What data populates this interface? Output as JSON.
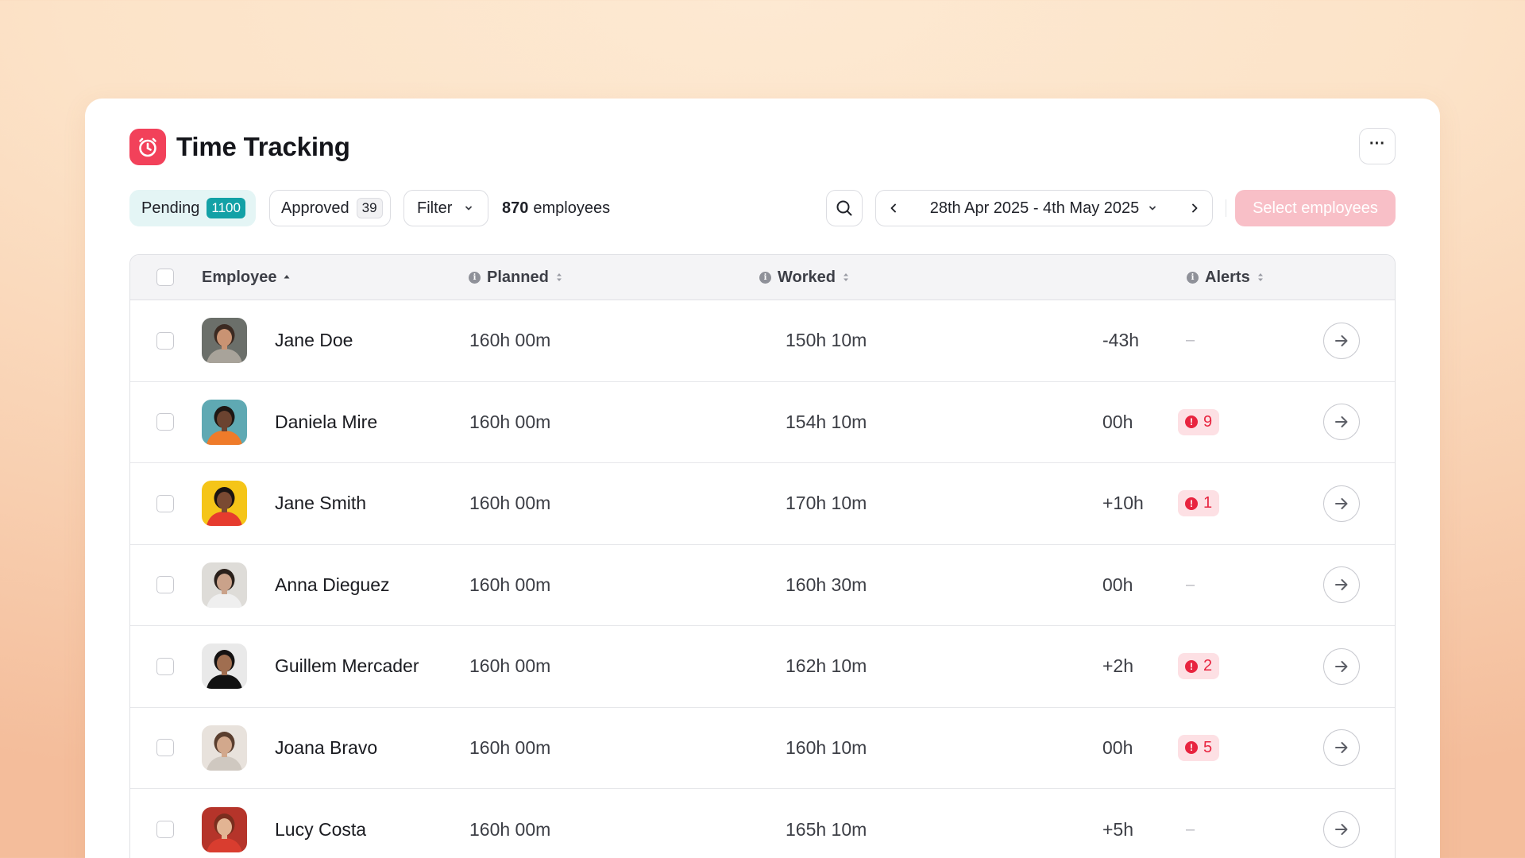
{
  "header": {
    "title": "Time Tracking",
    "more_label": "···"
  },
  "toolbar": {
    "pending_label": "Pending",
    "pending_count": "1100",
    "approved_label": "Approved",
    "approved_count": "39",
    "filter_label": "Filter",
    "employee_count": "870",
    "employee_count_suffix": "employees",
    "date_range": "28th Apr 2025 - 4th May 2025",
    "select_button": "Select employees"
  },
  "table": {
    "columns": {
      "employee": "Employee",
      "planned": "Planned",
      "worked": "Worked",
      "alerts": "Alerts"
    },
    "rows": [
      {
        "name": "Jane Doe",
        "planned": "160h 00m",
        "worked": "150h 10m",
        "diff": "-43h",
        "alerts": "–",
        "has_alerts": false,
        "avatar": {
          "bg": "#6b6f6a",
          "skin": "#c99373",
          "hair": "#3b2a22",
          "shirt": "#a8a39a"
        }
      },
      {
        "name": "Daniela Mire",
        "planned": "160h 00m",
        "worked": "154h 10m",
        "diff": "00h",
        "alerts": "9",
        "has_alerts": true,
        "avatar": {
          "bg": "#5fa9b3",
          "skin": "#6b4330",
          "hair": "#1e1714",
          "shirt": "#ef7b2a"
        }
      },
      {
        "name": "Jane Smith",
        "planned": "160h 00m",
        "worked": "170h 10m",
        "diff": "+10h",
        "alerts": "1",
        "has_alerts": true,
        "avatar": {
          "bg": "#f5c518",
          "skin": "#7a4a32",
          "hair": "#1a1412",
          "shirt": "#e63b2e"
        }
      },
      {
        "name": "Anna Dieguez",
        "planned": "160h 00m",
        "worked": "160h 30m",
        "diff": "00h",
        "alerts": "–",
        "has_alerts": false,
        "avatar": {
          "bg": "#dedcd8",
          "skin": "#caa28a",
          "hair": "#2a201b",
          "shirt": "#efefef"
        }
      },
      {
        "name": "Guillem Mercader",
        "planned": "160h 00m",
        "worked": "162h 10m",
        "diff": "+2h",
        "alerts": "2",
        "has_alerts": true,
        "avatar": {
          "bg": "#e9e9e9",
          "skin": "#a06e50",
          "hair": "#151212",
          "shirt": "#111111"
        }
      },
      {
        "name": "Joana Bravo",
        "planned": "160h 00m",
        "worked": "160h 10m",
        "diff": "00h",
        "alerts": "5",
        "has_alerts": true,
        "avatar": {
          "bg": "#e8e2dc",
          "skin": "#d2a88c",
          "hair": "#5a3e2e",
          "shirt": "#cfc8c0"
        }
      },
      {
        "name": "Lucy Costa",
        "planned": "160h 00m",
        "worked": "165h 10m",
        "diff": "+5h",
        "alerts": "–",
        "has_alerts": false,
        "avatar": {
          "bg": "#b5342a",
          "skin": "#e2b493",
          "hair": "#7a2e1e",
          "shirt": "#d93d2f"
        }
      }
    ]
  },
  "colors": {
    "brand": "#f2415a",
    "teal": "#12a1a6",
    "alert": "#e8243f"
  }
}
